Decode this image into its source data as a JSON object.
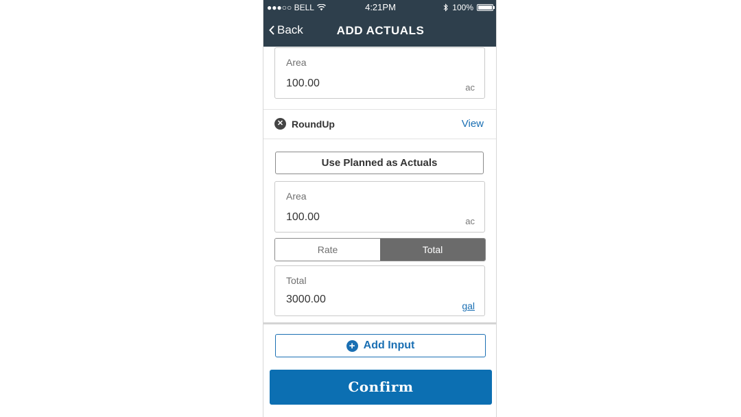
{
  "status_bar": {
    "carrier": "●●●○○ BELL",
    "time": "4:21PM",
    "battery": "100%"
  },
  "nav": {
    "back_label": "Back",
    "title": "ADD ACTUALS"
  },
  "top_field": {
    "label": "Area",
    "value": "100.00",
    "unit": "ac"
  },
  "product": {
    "name": "RoundUp",
    "view_label": "View"
  },
  "use_planned_label": "Use Planned as Actuals",
  "area_field": {
    "label": "Area",
    "value": "100.00",
    "unit": "ac"
  },
  "segment": {
    "options": [
      "Rate",
      "Total"
    ],
    "selected": "Total"
  },
  "total_field": {
    "label": "Total",
    "value": "3000.00",
    "unit": "gal"
  },
  "add_input_label": "Add Input",
  "confirm_label": "Confirm",
  "colors": {
    "header": "#2e3f4c",
    "accent": "#1a6fb3",
    "confirm": "#0c6fb2",
    "segment_active": "#6b6b6b"
  }
}
